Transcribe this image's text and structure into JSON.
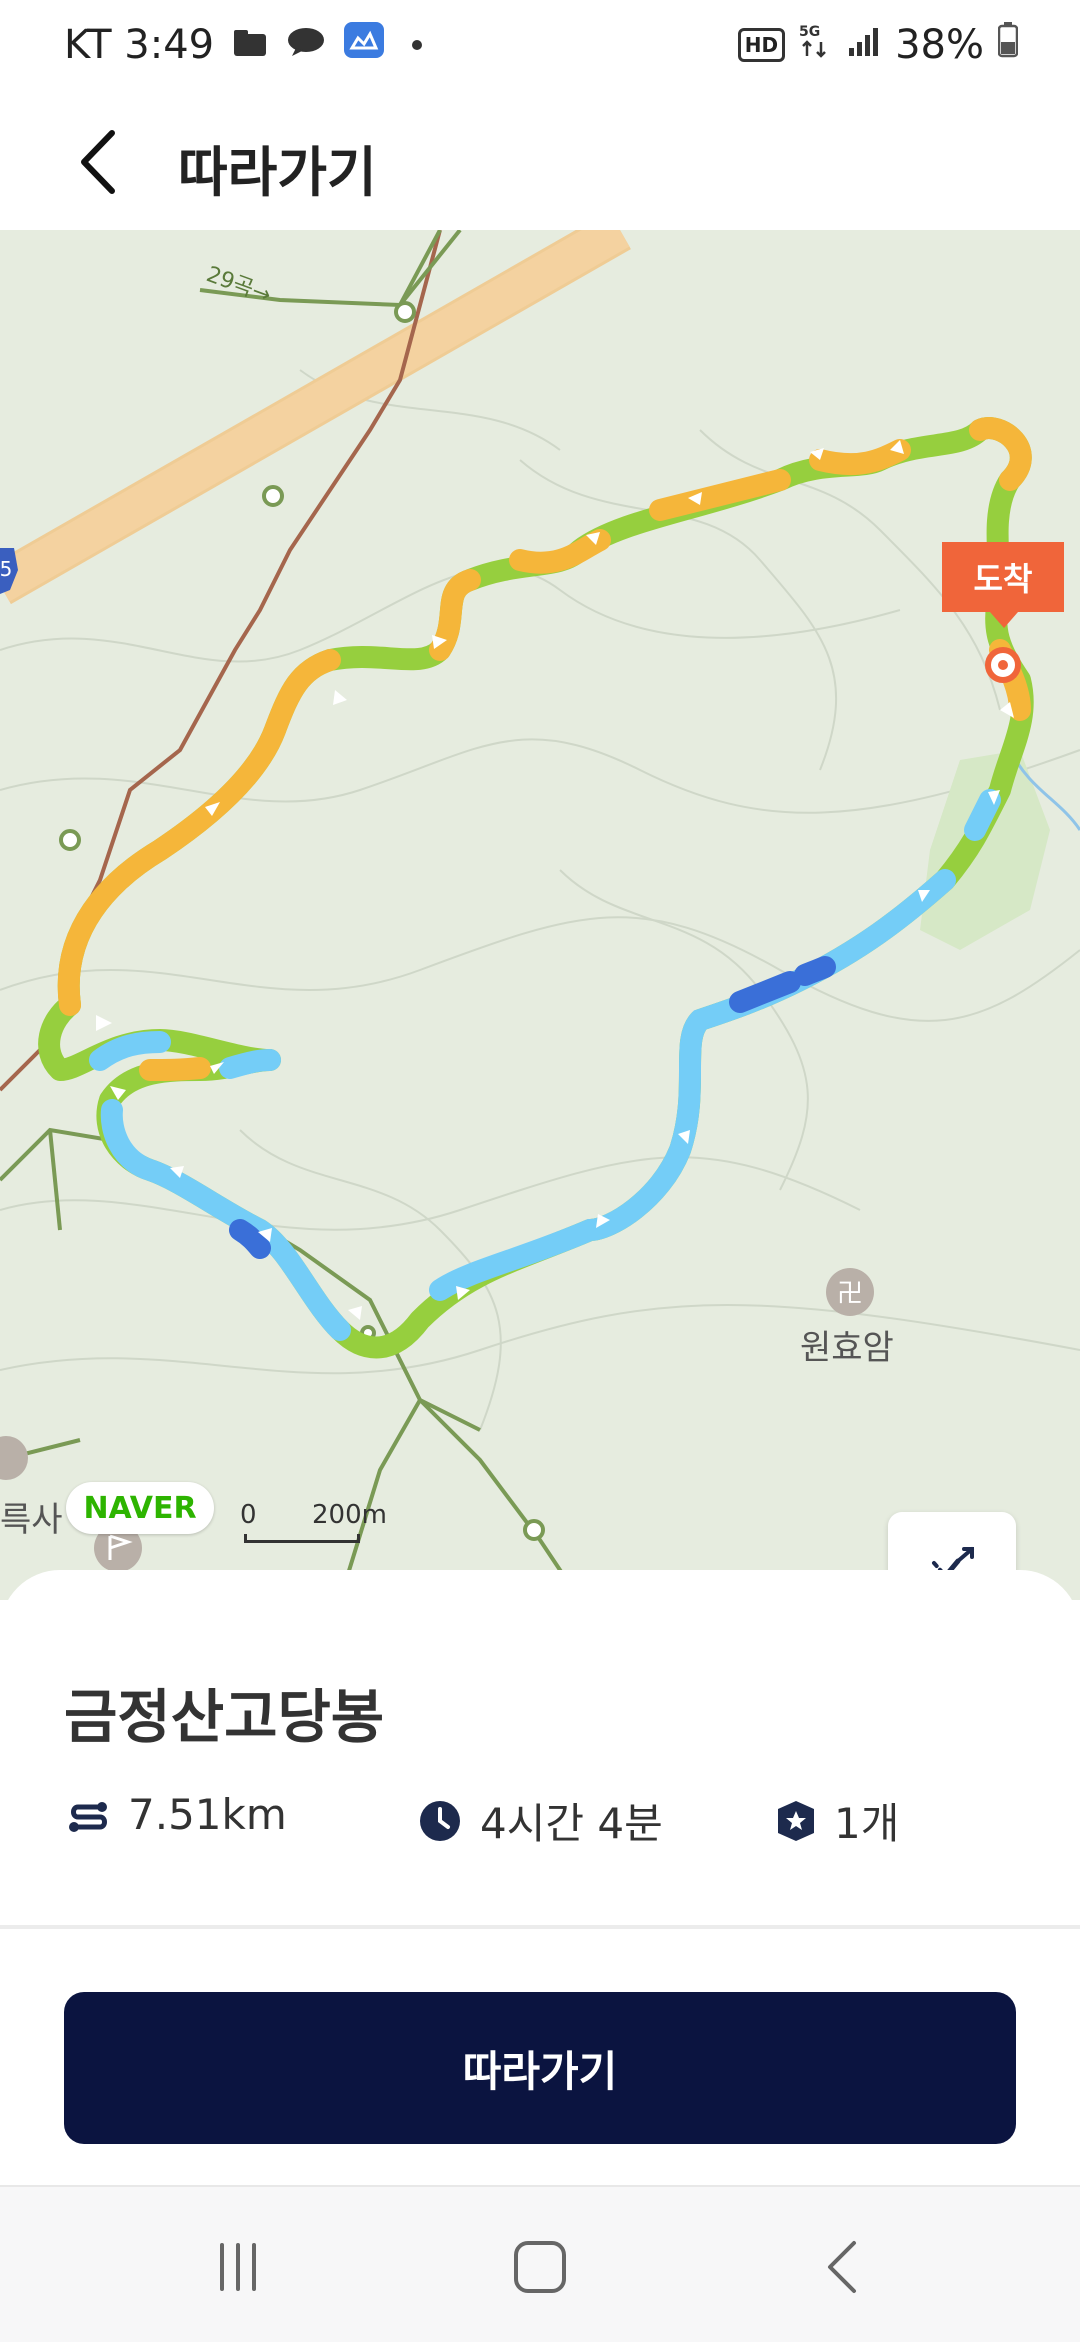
{
  "status": {
    "carrier_time": "KT 3:49",
    "battery": "38%",
    "icons": [
      "folder-icon",
      "chat-icon",
      "cloud-app-icon",
      "notification-dot",
      "hd-icon",
      "5g-icon",
      "signal-icon",
      "battery-icon"
    ]
  },
  "header": {
    "title": "따라가기",
    "back_icon": "chevron-left-icon"
  },
  "map": {
    "arrive_label": "도착",
    "place_label": "원효암",
    "left_label": "륵사",
    "road_label": "29곡→",
    "naver": "NAVER",
    "scale_zero": "0",
    "scale_label": "200m",
    "controls": [
      "elevation-toggle-icon",
      "reverse-route-icon"
    ],
    "route_colors": {
      "green": "#96cf3e",
      "orange": "#f5b63a",
      "skyblue": "#74cdf7",
      "blue": "#3a6fd8"
    }
  },
  "course": {
    "name": "금정산고당봉",
    "distance": "7.51km",
    "duration": "4시간 4분",
    "count": "1개"
  },
  "follow_button": "따라가기",
  "nav": [
    "recent-apps-icon",
    "home-icon",
    "back-icon"
  ]
}
